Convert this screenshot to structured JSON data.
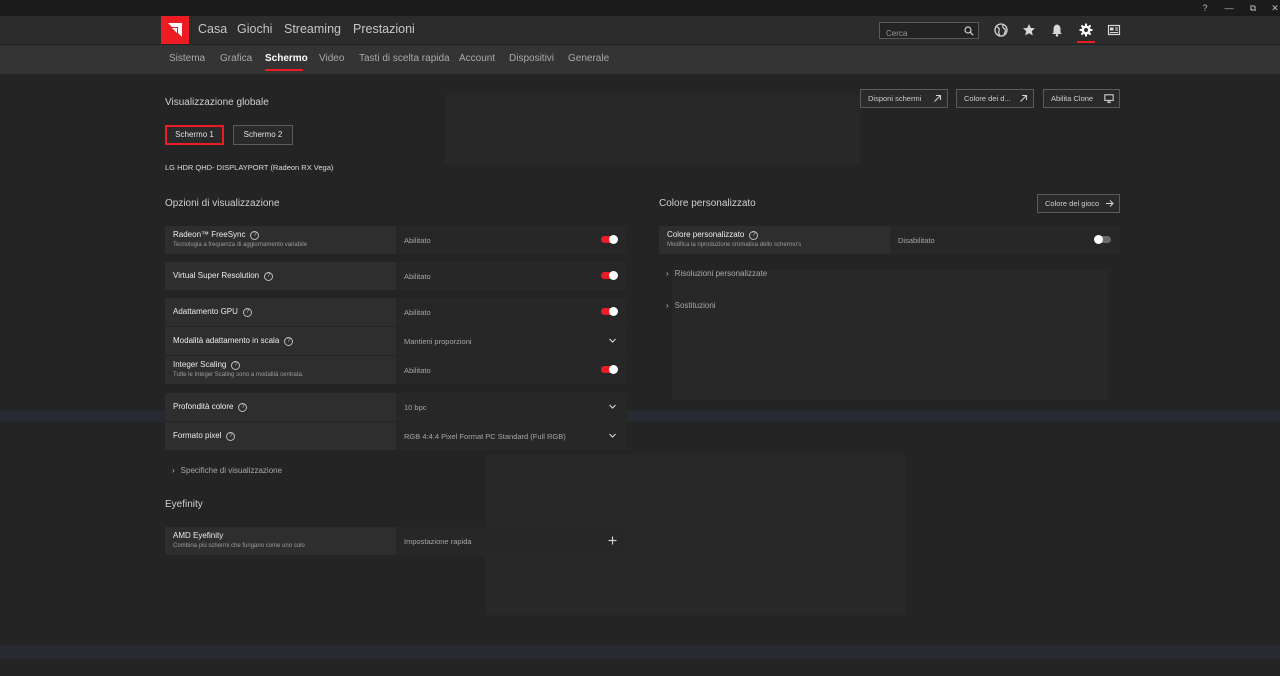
{
  "window": {
    "help_icon": "?",
    "restore_icon": "⧉",
    "close_icon": "✕"
  },
  "colors": {
    "accent": "#ed1c24",
    "background": "#242424",
    "row": "#2e2e2e",
    "toggle_on": "#ed1c24",
    "toggle_off": "#6a6a6a"
  },
  "nav": {
    "items": [
      "Casa",
      "Giochi",
      "Streaming",
      "Prestazioni"
    ],
    "search_placeholder": "Cerca",
    "icons": [
      "globe-icon",
      "star-icon",
      "bell-icon",
      "gear-icon",
      "news-icon"
    ],
    "active_icon": "gear-icon"
  },
  "subnav": {
    "items": [
      "Sistema",
      "Grafica",
      "Schermo",
      "Video",
      "Tasti di scelta rapida",
      "Account",
      "Dispositivi",
      "Generale"
    ],
    "active": "Schermo"
  },
  "global": {
    "title": "Visualizzazione globale",
    "actions": [
      "Disponi schermi",
      "Colore dei d...",
      "Abilita Clone"
    ],
    "screens": [
      "Schermo 1",
      "Schermo 2"
    ],
    "active_screen": "Schermo 1",
    "monitor": "LG HDR QHD- DISPLAYPORT (Radeon RX Vega)"
  },
  "options": {
    "title": "Opzioni di visualizzazione",
    "rows": [
      {
        "label": "Radeon™ FreeSync",
        "sub": "Tecnologia a frequenza di aggiornamento variabile",
        "value": "Abilitato",
        "control": "toggle",
        "on": true
      },
      {
        "label": "Virtual Super Resolution",
        "value": "Abilitato",
        "control": "toggle",
        "on": true
      },
      {
        "label": "Adattamento GPU",
        "value": "Abilitato",
        "control": "toggle",
        "on": true
      },
      {
        "label": "Modalità adattamento in scala",
        "value": "Mantieni proporzioni",
        "control": "dropdown"
      },
      {
        "label": "Integer Scaling",
        "sub": "Tutte le Integer Scaling sono a modalità centrata.",
        "value": "Abilitato",
        "control": "toggle",
        "on": true
      },
      {
        "label": "Profondità colore",
        "value": "10 bpc",
        "control": "dropdown"
      },
      {
        "label": "Formato pixel",
        "value": "RGB 4:4:4 Pixel Format PC Standard (Full RGB)",
        "control": "dropdown"
      }
    ],
    "expander": "Specifiche di visualizzazione"
  },
  "color": {
    "title": "Colore personalizzato",
    "game_color_button": "Colore del gioco",
    "row": {
      "label": "Colore personalizzato",
      "sub": "Modifica la riproduzione cromatica dello schermo's",
      "value": "Disabilitato",
      "on": false
    },
    "expanders": [
      "Risoluzioni personalizzate",
      "Sostituzioni"
    ]
  },
  "eyefinity": {
    "title": "Eyefinity",
    "row": {
      "label": "AMD Eyefinity",
      "sub": "Combina più schermi che fungano come uno solo",
      "value": "Impostazione rapida",
      "control": "plus"
    }
  }
}
